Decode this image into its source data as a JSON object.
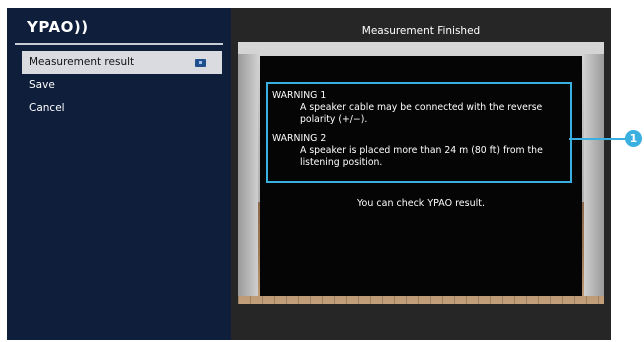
{
  "app": {
    "logo_text": "YPAO))"
  },
  "sidebar": {
    "items": [
      {
        "label": "Measurement result",
        "selected": true,
        "icon": "result-icon"
      },
      {
        "label": "Save"
      },
      {
        "label": "Cancel"
      }
    ]
  },
  "main": {
    "title": "Measurement Finished",
    "warnings": [
      {
        "title": "WARNING 1",
        "body": "A speaker cable may be connected with the reverse polarity (+/−)."
      },
      {
        "title": "WARNING 2",
        "body": "A speaker is placed more than 24 m (80 ft) from the listening position."
      }
    ],
    "check_message": "You can check YPAO result."
  },
  "callout": {
    "number": "1"
  },
  "colors": {
    "left_panel_bg": "#0e1e3b",
    "right_panel_bg": "#262626",
    "selected_item_bg": "#d9dbe0",
    "highlight_accent": "#39b0df"
  }
}
